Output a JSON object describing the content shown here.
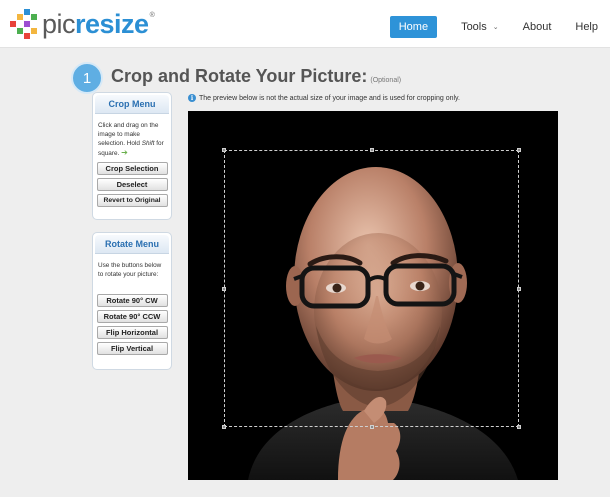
{
  "header": {
    "logo": {
      "pic": "pic",
      "resize": "resize",
      "reg": "®"
    },
    "nav": [
      {
        "label": "Home"
      },
      {
        "label": "Tools",
        "caret": "⌄"
      },
      {
        "label": "About"
      },
      {
        "label": "Help"
      }
    ]
  },
  "step": {
    "number": "1",
    "title": "Crop and Rotate Your Picture:",
    "optional": "(Optional)"
  },
  "info": {
    "icon": "i",
    "text": "The preview below is not the actual size of your image and is used for cropping only."
  },
  "crop_menu": {
    "title": "Crop Menu",
    "instructions_a": "Click and drag on the image to make selection. Hold ",
    "instructions_shift": "Shift",
    "instructions_b": " for square.",
    "arrow": "➔",
    "buttons": [
      "Crop Selection",
      "Deselect",
      "Revert to Original"
    ]
  },
  "rotate_menu": {
    "title": "Rotate Menu",
    "instructions": "Use the buttons below to rotate your picture:",
    "buttons": [
      "Rotate 90° CW",
      "Rotate 90° CCW",
      "Flip Horizontal",
      "Flip Vertical"
    ]
  },
  "colors": {
    "accent": "#2e93d8",
    "brand_blue": "#2b8fd4",
    "panel_title": "#2a6fb1",
    "step_circle": "#5faee3"
  }
}
